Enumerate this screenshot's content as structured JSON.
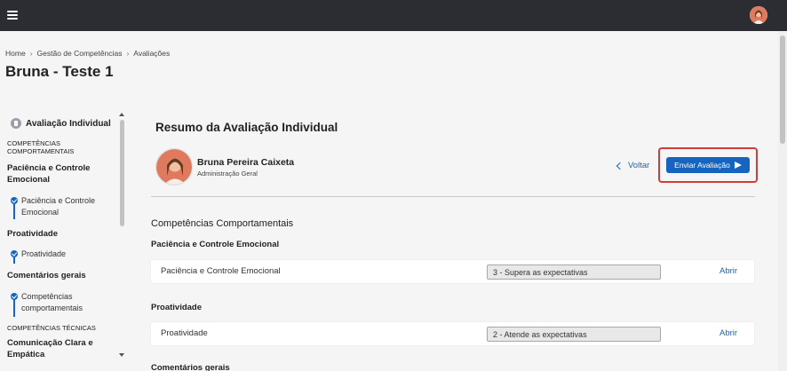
{
  "header": {
    "menu_icon": "hamburger-menu-icon",
    "user_avatar_icon": "user-avatar-icon"
  },
  "breadcrumb": {
    "items": [
      "Home",
      "Gestão de Competências",
      "Avaliações"
    ],
    "separator": "›"
  },
  "page": {
    "title": "Bruna - Teste 1"
  },
  "sidebar": {
    "header": "Avaliação Individual",
    "section_behavioral": "COMPETÊNCIAS COMPORTAMENTAIS",
    "group_1": "Paciência e Controle Emocional",
    "item_1": "Paciência e Controle Emocional",
    "group_2": "Proatividade",
    "item_2": "Proatividade",
    "group_3": "Comentários gerais",
    "item_3": "Competências comportamentais",
    "section_technical": "COMPETÊNCIAS TÉCNICAS",
    "group_4": "Comunicação Clara e Empática"
  },
  "main": {
    "title": "Resumo da Avaliação Individual",
    "person": {
      "name": "Bruna Pereira Caixeta",
      "role": "Administração Geral"
    },
    "back_label": "Voltar",
    "send_label": "Enviar Avaliação",
    "section_title": "Competências Comportamentais",
    "groups": [
      {
        "title": "Paciência e Controle Emocional",
        "row_label": "Paciência e Controle Emocional",
        "rating": "3 - Supera as expectativas",
        "action": "Abrir"
      },
      {
        "title": "Proatividade",
        "row_label": "Proatividade",
        "rating": "2 - Atende as expectativas",
        "action": "Abrir"
      }
    ],
    "next_section_peek": "Comentários gerais"
  },
  "colors": {
    "topbar": "#2b2d33",
    "accent": "#1565c0",
    "highlight": "#d33a3a"
  }
}
